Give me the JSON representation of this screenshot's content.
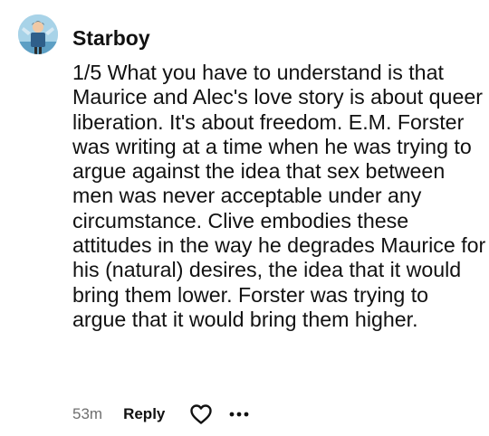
{
  "comment": {
    "avatar_icon": "user-avatar-illustration",
    "username": "Starboy",
    "text": "1/5 What you have to understand is that Maurice and Alec's love story is about queer liberation. It's about freedom. E.M. Forster was writing at a time when he was trying to argue against the idea that sex between men was never acceptable under any circumstance. Clive embodies these attitudes in the way he degrades Maurice for his (natural) desires, the idea that it would bring them lower. Forster was trying to argue that it would bring them higher.",
    "timestamp": "53m",
    "reply_label": "Reply",
    "like_icon": "heart-outline-icon",
    "more_icon": "ellipsis-icon"
  },
  "colors": {
    "text": "#111111",
    "muted": "#6f6f6f",
    "background": "#ffffff"
  }
}
